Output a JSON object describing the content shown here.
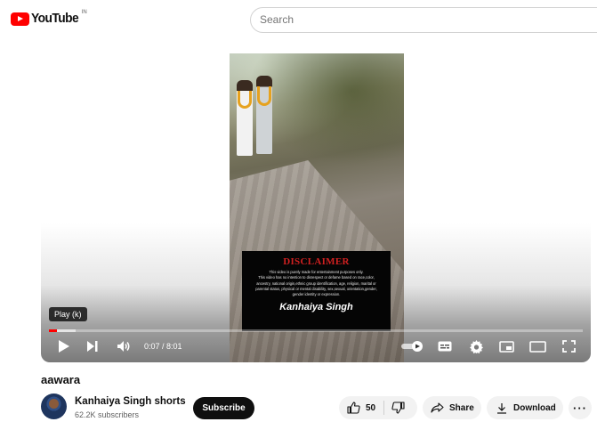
{
  "header": {
    "logo_text": "YouTube",
    "country_code": "IN",
    "search_placeholder": "Search"
  },
  "player": {
    "disclaimer": {
      "title": "DISCLAIMER",
      "lines": [
        "This video is purely made for entertainment purposes only.",
        "This video has no intention to disrespect or defame based on race,color,",
        "ancestry, national origin,ethnic group identification, age, religion, marital or",
        "parental status, physical or mental disability, sex,sexual, orientation,gender,",
        "gender identity or expression."
      ],
      "signature": "Kanhaiya Singh"
    },
    "tooltip": "Play (k)",
    "time_display": "0:07 / 8:01",
    "progress_fraction": 0.0146,
    "accent_color": "#ff0000",
    "controls": {
      "play": "play-icon",
      "next": "next-icon",
      "volume": "volume-icon",
      "autoplay": "autoplay-toggle",
      "captions": "captions-icon",
      "settings": "gear-icon",
      "miniplayer": "miniplayer-icon",
      "theater": "theater-icon",
      "fullscreen": "fullscreen-icon"
    }
  },
  "video": {
    "title": "aawara",
    "channel_name": "Kanhaiya Singh shorts",
    "subscribers": "62.2K subscribers",
    "subscribe_label": "Subscribe",
    "like_count": "50",
    "share_label": "Share",
    "download_label": "Download",
    "more_label": "···"
  }
}
